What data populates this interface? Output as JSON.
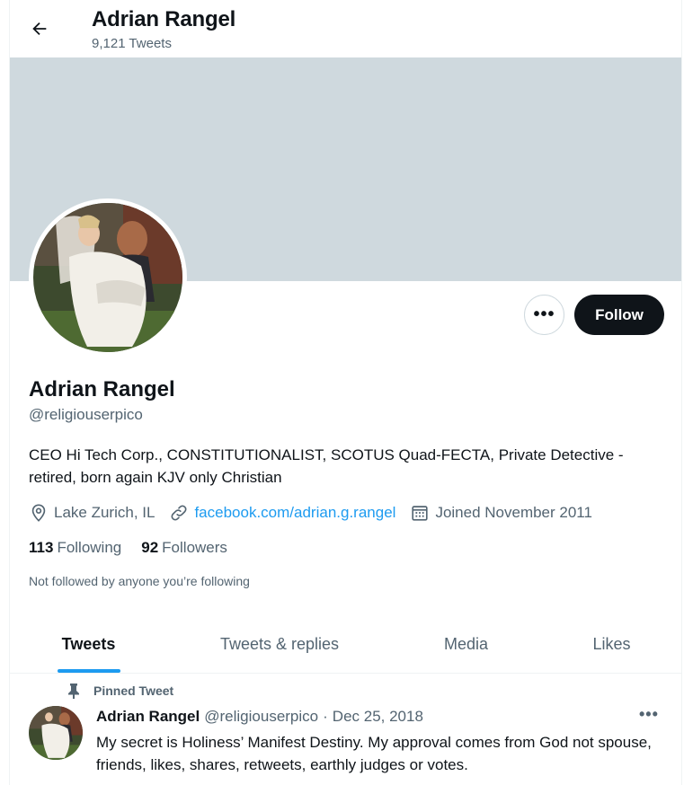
{
  "header": {
    "back_icon": "arrow-left-icon",
    "title": "Adrian Rangel",
    "tweet_count": "9,121 Tweets"
  },
  "colors": {
    "banner": "#cfd9de",
    "accent": "#1d9bf0",
    "follow_bg": "#0f1419",
    "secondary_text": "#536471"
  },
  "profile": {
    "more_label": "•••",
    "follow_label": "Follow",
    "name": "Adrian Rangel",
    "handle": "@religiouserpico",
    "bio": "CEO Hi Tech Corp., CONSTITUTIONALIST, SCOTUS Quad-FECTA, Private Detective - retired, born again KJV only Christian",
    "location": "Lake Zurich, IL",
    "website": "facebook.com/adrian.g.rangel",
    "joined": "Joined November 2011",
    "following_count": "113",
    "following_label": "Following",
    "followers_count": "92",
    "followers_label": "Followers",
    "not_followed": "Not followed by anyone you’re following"
  },
  "tabs": [
    {
      "label": "Tweets",
      "active": true
    },
    {
      "label": "Tweets & replies",
      "active": false
    },
    {
      "label": "Media",
      "active": false
    },
    {
      "label": "Likes",
      "active": false
    }
  ],
  "pinned_tweet": {
    "pinned_label": "Pinned Tweet",
    "author_name": "Adrian Rangel",
    "author_handle": "@religiouserpico",
    "separator": "·",
    "date": "Dec 25, 2018",
    "more_label": "•••",
    "text": "My secret is Holiness’ Manifest Destiny. My approval comes from God not spouse, friends, likes, shares, retweets, earthly judges or votes."
  }
}
